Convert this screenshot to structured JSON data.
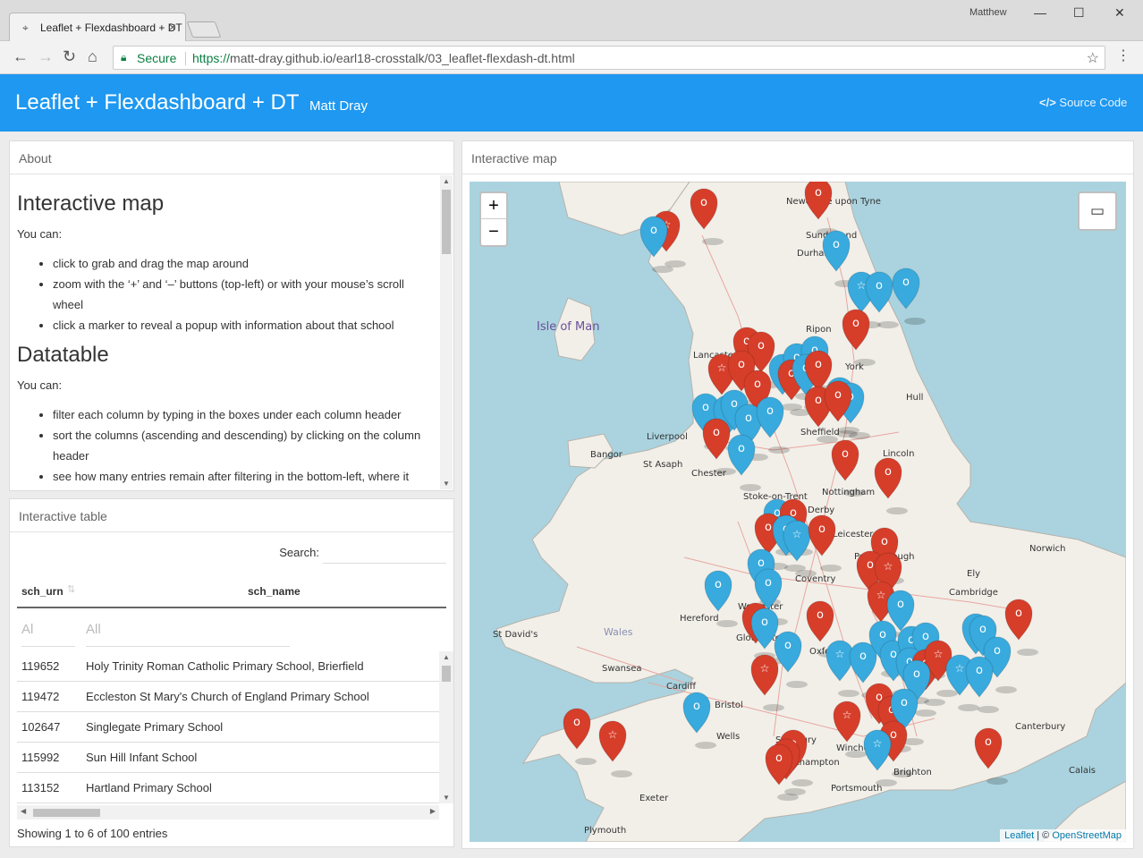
{
  "browser": {
    "tab_title": "Leaflet + Flexdashboard + DT",
    "user": "Matthew",
    "secure_label": "Secure",
    "url_scheme": "https://",
    "url_rest": "matt-dray.github.io/earl18-crosstalk/03_leaflet-flexdash-dt.html"
  },
  "navbar": {
    "title": "Leaflet + Flexdashboard + DT",
    "author": "Matt Dray",
    "source_label": "Source Code"
  },
  "about": {
    "card_title": "About",
    "h_map": "Interactive map",
    "p_map": "You can:",
    "map_items": [
      "click to grab and drag the map around",
      "zoom with the ‘+’ and ‘–’ buttons (top-left) or with your mouse’s scroll wheel",
      "click a marker to reveal a popup with information about that school"
    ],
    "h_table": "Datatable",
    "p_table": "You can:",
    "table_items": [
      "filter each column by typing in the boxes under each column header",
      "sort the columns (ascending and descending) by clicking on the column header",
      "see how many entries remain after filtering in the bottom-left, where it"
    ]
  },
  "table": {
    "card_title": "Interactive table",
    "search_label": "Search:",
    "col_urn": "sch_urn",
    "col_name": "sch_name",
    "filter_urn": "Al",
    "filter_name": "All",
    "rows": [
      {
        "urn": "119652",
        "name": "Holy Trinity Roman Catholic Primary School, Brierfield"
      },
      {
        "urn": "119472",
        "name": "Eccleston St Mary's Church of England Primary School"
      },
      {
        "urn": "102647",
        "name": "Singlegate Primary School"
      },
      {
        "urn": "115992",
        "name": "Sun Hill Infant School"
      },
      {
        "urn": "113152",
        "name": "Hartland Primary School"
      }
    ],
    "info": "Showing 1 to 6 of 100 entries"
  },
  "map": {
    "card_title": "Interactive map",
    "zoom_in": "+",
    "zoom_out": "−",
    "attrib_leaflet": "Leaflet",
    "attrib_sep": " | © ",
    "attrib_osm": "OpenStreetMap",
    "labels": [
      "Isle of Man",
      "Sunderland",
      "Durham",
      "Ripon",
      "York",
      "Lancaster",
      "Hull",
      "Liverpool",
      "Sheffield",
      "Bangor",
      "St Asaph",
      "Chester",
      "Lincoln",
      "Nottingham",
      "Stoke-on-Trent",
      "Derby",
      "Leicester",
      "Norwich",
      "Peterborough",
      "Ely",
      "Coventry",
      "Cambridge",
      "Hereford",
      "Worcester",
      "Gloucester",
      "St David's",
      "Wales",
      "Oxford",
      "Swansea",
      "Cardiff",
      "Bristol",
      "Wells",
      "Salisbury",
      "Winchester",
      "Southampton",
      "Portsmouth",
      "Brighton",
      "Canterbury",
      "Calais",
      "Exeter",
      "Plymouth",
      "Newcastle upon Tyne"
    ],
    "colors": {
      "red": "#d63e2a",
      "blue": "#38aadd",
      "land": "#f2efe9",
      "sea": "#aad3df"
    }
  }
}
